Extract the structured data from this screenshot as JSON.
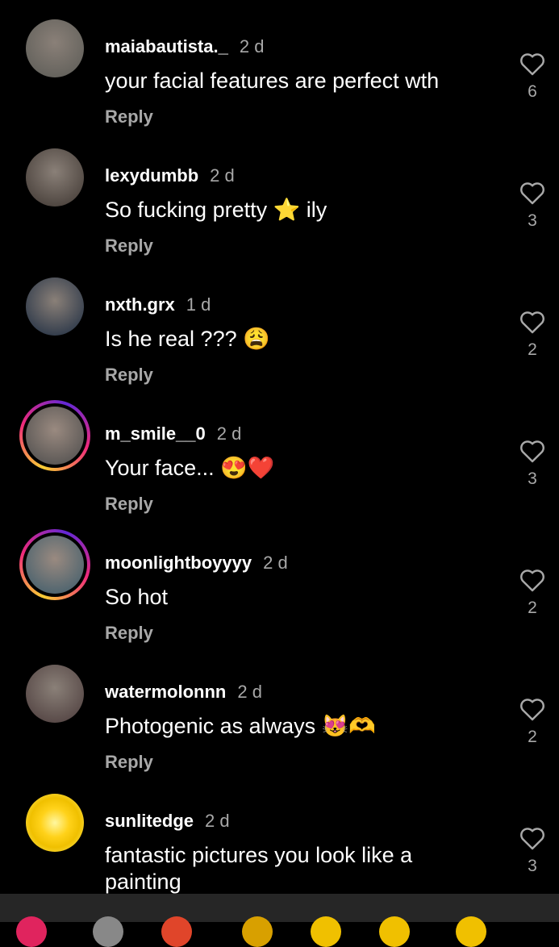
{
  "comments": [
    {
      "username": "maiabautista._",
      "time": "2 d",
      "text": "your facial features are perfect wth",
      "reply": "Reply",
      "likes": "6",
      "story": false,
      "avatar_color": "#5a5a55"
    },
    {
      "username": "lexydumbb",
      "time": "2 d",
      "text": "So fucking pretty ⭐ ily",
      "reply": "Reply",
      "likes": "3",
      "story": false,
      "avatar_color": "#3d3530"
    },
    {
      "username": "nxth.grx",
      "time": "1 d",
      "text": "Is he real ??? 😩",
      "reply": "Reply",
      "likes": "2",
      "story": false,
      "avatar_color": "#1a2a40"
    },
    {
      "username": "m_smile__0",
      "time": "2 d",
      "text": "Your face... 😍❤️",
      "reply": "Reply",
      "likes": "3",
      "story": true,
      "avatar_color": "#4a4a4a"
    },
    {
      "username": "moonlightboyyyy",
      "time": "2 d",
      "text": "So hot",
      "reply": "Reply",
      "likes": "2",
      "story": true,
      "avatar_color": "#3a5a6a"
    },
    {
      "username": "watermolonnn",
      "time": "2 d",
      "text": "Photogenic as always 😻🫶",
      "reply": "Reply",
      "likes": "2",
      "story": false,
      "avatar_color": "#4a3a3a"
    },
    {
      "username": "sunlitedge",
      "time": "2 d",
      "text": "fantastic pictures you look like a painting",
      "reply": "",
      "likes": "3",
      "story": false,
      "avatar_color": "#f5d020"
    }
  ],
  "emoji_bar": [
    "❤️",
    "🙌",
    "🔥",
    "👏",
    "😢",
    "😍",
    "😮"
  ]
}
